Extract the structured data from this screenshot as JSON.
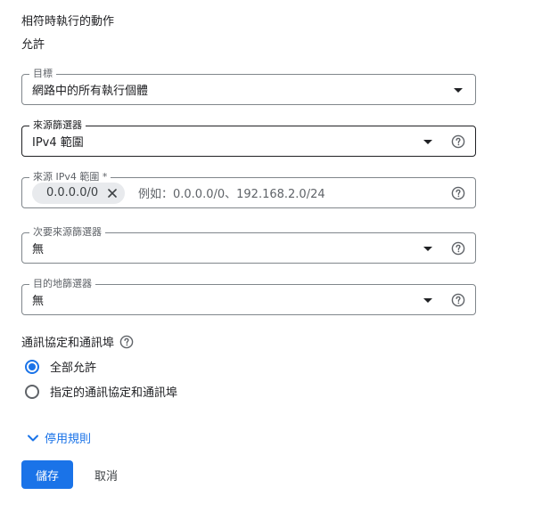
{
  "header": {
    "title": "相符時執行的動作",
    "value": "允許"
  },
  "fields": {
    "target": {
      "label": "目標",
      "value": "網路中的所有執行個體"
    },
    "source_filter": {
      "label": "來源篩選器",
      "value": "IPv4 範圍"
    },
    "source_ipv4": {
      "label": "來源 IPv4 範圍 *",
      "chip": "0.0.0.0/0",
      "placeholder": "例如：0.0.0.0/0、192.168.2.0/24"
    },
    "secondary_source_filter": {
      "label": "次要來源篩選器",
      "value": "無"
    },
    "destination_filter": {
      "label": "目的地篩選器",
      "value": "無"
    }
  },
  "protocols": {
    "title": "通訊協定和通訊埠",
    "options": [
      {
        "label": "全部允許",
        "checked": true
      },
      {
        "label": "指定的通訊協定和通訊埠",
        "checked": false
      }
    ]
  },
  "toggle_link": {
    "label": "停用規則"
  },
  "actions": {
    "save": "儲存",
    "cancel": "取消"
  },
  "colors": {
    "accent": "#1a73e8",
    "border": "#80868b",
    "chip_bg": "#e8eaed"
  }
}
